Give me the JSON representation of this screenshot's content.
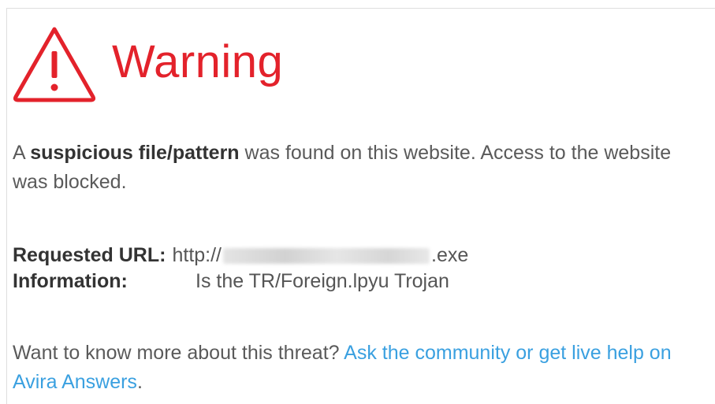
{
  "header": {
    "title": "Warning",
    "icon": "warning-triangle-icon",
    "accent_color": "#e3222b"
  },
  "message": {
    "prefix": "A ",
    "bold": "suspicious file/pattern",
    "suffix": " was found on this website. Access to the website was blocked."
  },
  "details": {
    "url_label": "Requested URL:",
    "url_prefix": "http://",
    "url_suffix": ".exe",
    "info_label": "Information:",
    "info_value": "Is the TR/Foreign.lpyu Trojan"
  },
  "more": {
    "question": "Want to know more about this threat? ",
    "link_text": "Ask the community or get live help on Avira Answers",
    "end": ".",
    "link_color": "#3aa0e0"
  }
}
